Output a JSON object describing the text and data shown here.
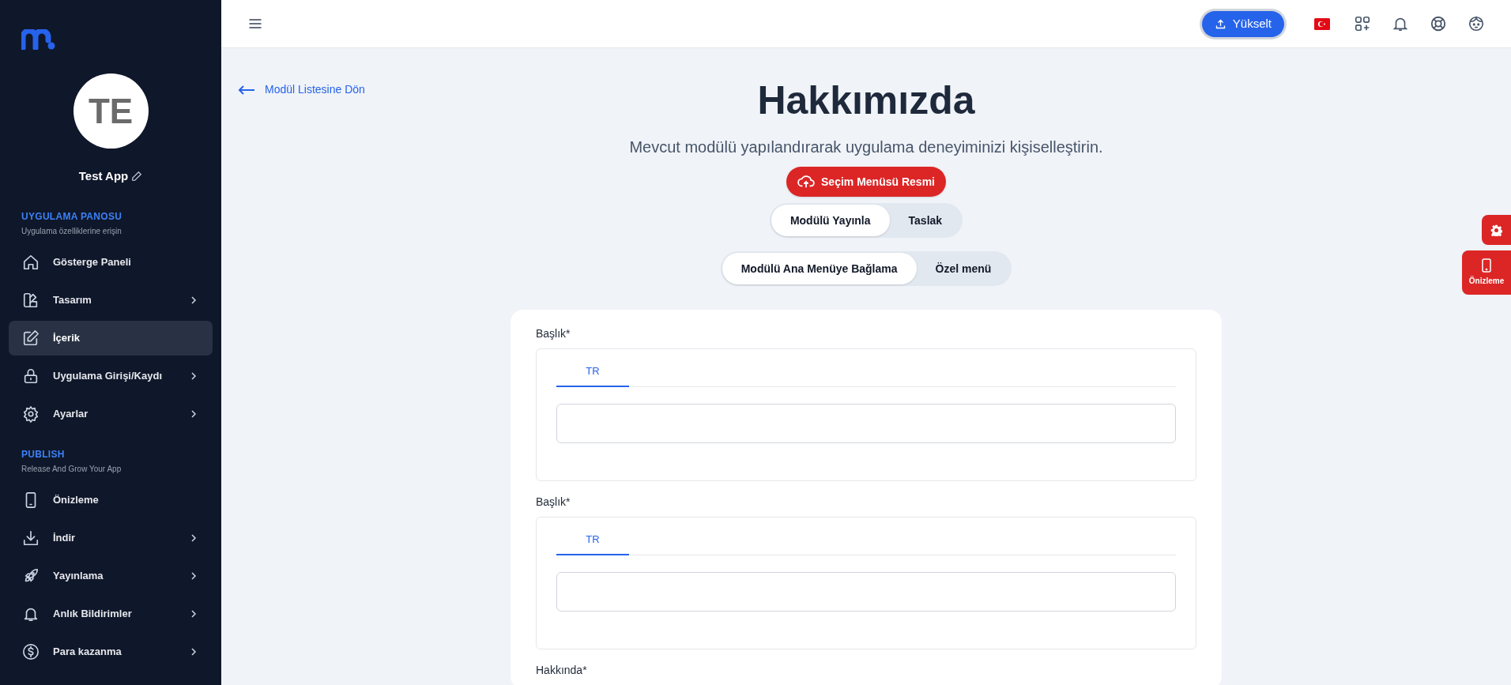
{
  "sidebar": {
    "app_name": "Test App",
    "avatar_initials": "TE",
    "sections": [
      {
        "title": "UYGULAMA PANOSU",
        "subtitle": "Uygulama özelliklerine erişin",
        "items": [
          {
            "label": "Gösterge Paneli",
            "selected": false,
            "has_submenu": false
          },
          {
            "label": "Tasarım",
            "selected": false,
            "has_submenu": true
          },
          {
            "label": "İçerik",
            "selected": true,
            "has_submenu": false
          },
          {
            "label": "Uygulama Girişi/Kaydı",
            "selected": false,
            "has_submenu": true
          },
          {
            "label": "Ayarlar",
            "selected": false,
            "has_submenu": true
          }
        ]
      },
      {
        "title": "PUBLISH",
        "subtitle": "Release And Grow Your App",
        "items": [
          {
            "label": "Önizleme",
            "selected": false,
            "has_submenu": false
          },
          {
            "label": "İndir",
            "selected": false,
            "has_submenu": true
          },
          {
            "label": "Yayınlama",
            "selected": false,
            "has_submenu": true
          },
          {
            "label": "Anlık Bildirimler",
            "selected": false,
            "has_submenu": true
          },
          {
            "label": "Para kazanma",
            "selected": false,
            "has_submenu": true
          }
        ]
      }
    ]
  },
  "topbar": {
    "upgrade_button": "Yükselt"
  },
  "back_link": "Modül Listesine Dön",
  "title": "Hakkımızda",
  "subtitle": "Mevcut modülü yapılandırarak uygulama deneyiminizi kişiselleştirin.",
  "image_button": "Seçim Menüsü Resmi",
  "toggles": [
    [
      {
        "label": "Modülü Yayınla",
        "selected": true
      },
      {
        "label": "Taslak",
        "selected": false
      }
    ],
    [
      {
        "label": "Modülü Ana Menüye Bağlama",
        "selected": true
      },
      {
        "label": "Özel menü",
        "selected": false
      }
    ]
  ],
  "fields": [
    {
      "label": "Başlık*",
      "tabs": [
        {
          "label": "TR",
          "selected": true
        }
      ]
    },
    {
      "label": "Başlık*",
      "tabs": [
        {
          "label": "TR",
          "selected": true
        }
      ]
    },
    {
      "label": "Hakkında*"
    }
  ],
  "floating": {
    "preview_label": "Önizleme"
  }
}
